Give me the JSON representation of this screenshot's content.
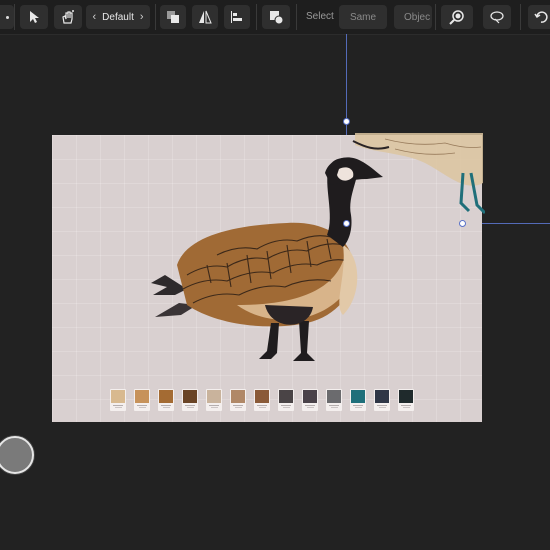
{
  "toolbar": {
    "style_preset": "Default",
    "select_label": "Select",
    "same_label": "Same",
    "object_label": "Objec"
  },
  "colors": {
    "background": "#222222",
    "canvas": "#d9d0d0",
    "guide": "#5a73c9"
  },
  "swatches": [
    {
      "color": "#d8b98f"
    },
    {
      "color": "#c7925a"
    },
    {
      "color": "#a46b33"
    },
    {
      "color": "#6a4426"
    },
    {
      "color": "#c9b39c"
    },
    {
      "color": "#b08867"
    },
    {
      "color": "#8a5a38"
    },
    {
      "color": "#4a4446"
    },
    {
      "color": "#4a4249"
    },
    {
      "color": "#6b6b6e"
    },
    {
      "color": "#1f6f7a"
    },
    {
      "color": "#2f3646"
    },
    {
      "color": "#1f2a2c"
    }
  ]
}
